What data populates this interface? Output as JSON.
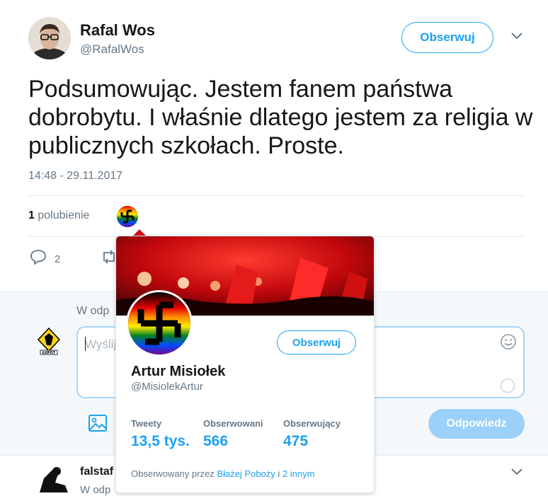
{
  "tweet": {
    "author_name": "Rafal Wos",
    "author_handle": "@RafalWos",
    "follow_label": "Obserwuj",
    "text": "Podsumowując. Jestem fanem państwa dobrobytu. I właśnie dlatego jestem za religia w publicznych szkołach. Proste.",
    "timestamp": "14:48 - 29.11.2017",
    "likes_count": "1",
    "likes_label": "polubienie",
    "reply_count": "2"
  },
  "reply_box": {
    "reply_to_prefix": "W odp",
    "placeholder": "Wyślij",
    "submit_label": "Odpowiedz"
  },
  "next_reply": {
    "name_partial": "falstaf",
    "sub_partial": "W odp"
  },
  "hover_card": {
    "follow_label": "Obserwuj",
    "name": "Artur Misiołek",
    "handle": "@MisiolekArtur",
    "stats": [
      {
        "label": "Tweety",
        "value": "13,5 tys."
      },
      {
        "label": "Obserwowani",
        "value": "566"
      },
      {
        "label": "Obserwujący",
        "value": "475"
      }
    ],
    "followed_by_prefix": "Obserwowany przez",
    "followed_by_link1": "Błażej Poboży",
    "followed_by_mid": "i",
    "followed_by_link2": "2 innym"
  },
  "colors": {
    "accent": "#1da1f2",
    "muted_text": "#657786",
    "reply_button_disabled": "#9ad0f9",
    "banner_red": "#d10d12"
  }
}
